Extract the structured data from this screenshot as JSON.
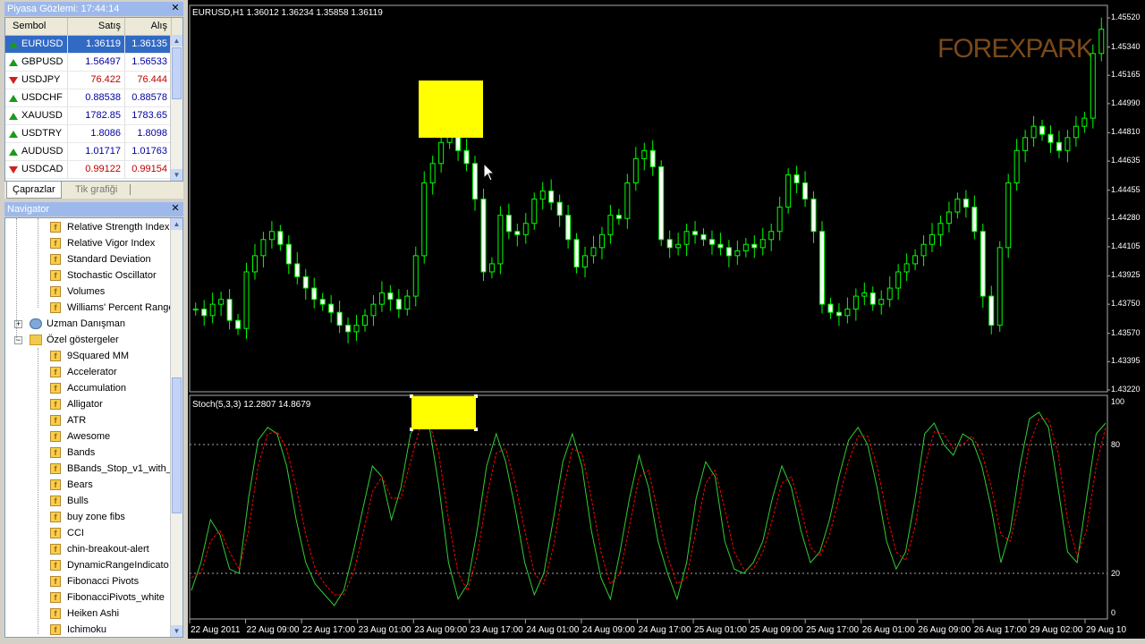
{
  "market_watch": {
    "title": "Piyasa Gözlemi: 17:44:14",
    "headers": {
      "symbol": "Sembol",
      "sell": "Satış",
      "buy": "Alış"
    },
    "rows": [
      {
        "symbol": "EURUSD",
        "sell": "1.36119",
        "buy": "1.36135",
        "dir": "up",
        "selected": true,
        "color": "#0000a0"
      },
      {
        "symbol": "GBPUSD",
        "sell": "1.56497",
        "buy": "1.56533",
        "dir": "up",
        "selected": false,
        "color": "#0000a0"
      },
      {
        "symbol": "USDJPY",
        "sell": "76.422",
        "buy": "76.444",
        "dir": "down",
        "selected": false,
        "color": "#c00000"
      },
      {
        "symbol": "USDCHF",
        "sell": "0.88538",
        "buy": "0.88578",
        "dir": "up",
        "selected": false,
        "color": "#0000a0"
      },
      {
        "symbol": "XAUUSD",
        "sell": "1782.85",
        "buy": "1783.65",
        "dir": "up",
        "selected": false,
        "color": "#0000a0"
      },
      {
        "symbol": "USDTRY",
        "sell": "1.8086",
        "buy": "1.8098",
        "dir": "up",
        "selected": false,
        "color": "#0000a0"
      },
      {
        "symbol": "AUDUSD",
        "sell": "1.01717",
        "buy": "1.01763",
        "dir": "up",
        "selected": false,
        "color": "#0000a0"
      },
      {
        "symbol": "USDCAD",
        "sell": "0.99122",
        "buy": "0.99154",
        "dir": "down",
        "selected": false,
        "color": "#c00000"
      }
    ],
    "tabs": [
      "Çaprazlar",
      "Tik grafiği"
    ]
  },
  "navigator": {
    "title": "Navigator",
    "items": [
      {
        "label": "Relative Strength Index",
        "level": 2,
        "type": "indicator"
      },
      {
        "label": "Relative Vigor Index",
        "level": 2,
        "type": "indicator"
      },
      {
        "label": "Standard Deviation",
        "level": 2,
        "type": "indicator"
      },
      {
        "label": "Stochastic Oscillator",
        "level": 2,
        "type": "indicator"
      },
      {
        "label": "Volumes",
        "level": 2,
        "type": "indicator"
      },
      {
        "label": "Williams' Percent Range",
        "level": 2,
        "type": "indicator"
      },
      {
        "label": "Uzman Danışman",
        "level": 1,
        "type": "ea",
        "expander": "+"
      },
      {
        "label": "Özel göstergeler",
        "level": 1,
        "type": "folder",
        "expander": "−"
      },
      {
        "label": "9Squared MM",
        "level": 2,
        "type": "custom"
      },
      {
        "label": "Accelerator",
        "level": 2,
        "type": "custom"
      },
      {
        "label": "Accumulation",
        "level": 2,
        "type": "custom"
      },
      {
        "label": "Alligator",
        "level": 2,
        "type": "custom"
      },
      {
        "label": "ATR",
        "level": 2,
        "type": "custom"
      },
      {
        "label": "Awesome",
        "level": 2,
        "type": "custom"
      },
      {
        "label": "Bands",
        "level": 2,
        "type": "custom"
      },
      {
        "label": "BBands_Stop_v1_with_",
        "level": 2,
        "type": "custom"
      },
      {
        "label": "Bears",
        "level": 2,
        "type": "custom"
      },
      {
        "label": "Bulls",
        "level": 2,
        "type": "custom"
      },
      {
        "label": "buy zone fibs",
        "level": 2,
        "type": "custom"
      },
      {
        "label": "CCI",
        "level": 2,
        "type": "custom"
      },
      {
        "label": "chin-breakout-alert",
        "level": 2,
        "type": "custom"
      },
      {
        "label": "DynamicRangeIndicato",
        "level": 2,
        "type": "custom"
      },
      {
        "label": "Fibonacci Pivots",
        "level": 2,
        "type": "custom"
      },
      {
        "label": "FibonacciPivots_white",
        "level": 2,
        "type": "custom"
      },
      {
        "label": "Heiken Ashi",
        "level": 2,
        "type": "custom"
      },
      {
        "label": "Ichimoku",
        "level": 2,
        "type": "custom"
      }
    ]
  },
  "chart": {
    "header": "EURUSD,H1  1.36012 1.36234 1.35858 1.36119",
    "logo": "FOREXPARK",
    "price_ticks": [
      "1.45520",
      "1.45340",
      "1.45165",
      "1.44990",
      "1.44810",
      "1.44635",
      "1.44455",
      "1.44280",
      "1.44105",
      "1.43925",
      "1.43750",
      "1.43570",
      "1.43395",
      "1.43220"
    ],
    "stoch_label": "Stoch(5,3,3) 12.2807 14.8679",
    "stoch_ticks": [
      "100",
      "80",
      "20",
      "0"
    ],
    "time_labels": [
      "22 Aug 2011",
      "22 Aug 09:00",
      "22 Aug 17:00",
      "23 Aug 01:00",
      "23 Aug 09:00",
      "23 Aug 17:00",
      "24 Aug 01:00",
      "24 Aug 09:00",
      "24 Aug 17:00",
      "25 Aug 01:00",
      "25 Aug 09:00",
      "25 Aug 17:00",
      "26 Aug 01:00",
      "26 Aug 09:00",
      "26 Aug 17:00",
      "29 Aug 02:00",
      "29 Aug 10"
    ],
    "candle_color": "#00ff00",
    "candle_body": "#ffffff",
    "stoch_main_color": "#32cd32",
    "stoch_signal_color": "#ff0000",
    "highlight_color": "#ffff00",
    "close_path": [
      1.4372,
      1.4368,
      1.4375,
      1.4378,
      1.4365,
      1.436,
      1.4395,
      1.4405,
      1.4415,
      1.442,
      1.4412,
      1.44,
      1.4392,
      1.4385,
      1.4378,
      1.4375,
      1.437,
      1.4362,
      1.4358,
      1.4362,
      1.4368,
      1.4375,
      1.4382,
      1.4378,
      1.4372,
      1.438,
      1.4405,
      1.445,
      1.4462,
      1.4475,
      1.448,
      1.447,
      1.4462,
      1.444,
      1.4395,
      1.44,
      1.443,
      1.442,
      1.4418,
      1.4425,
      1.444,
      1.4445,
      1.4438,
      1.443,
      1.4415,
      1.4398,
      1.4405,
      1.441,
      1.4418,
      1.443,
      1.4428,
      1.445,
      1.4465,
      1.447,
      1.446,
      1.4415,
      1.441,
      1.4412,
      1.442,
      1.4418,
      1.4415,
      1.4412,
      1.441,
      1.4405,
      1.4408,
      1.4412,
      1.441,
      1.4415,
      1.442,
      1.4435,
      1.4455,
      1.445,
      1.444,
      1.442,
      1.4375,
      1.437,
      1.4368,
      1.4372,
      1.438,
      1.4382,
      1.4375,
      1.4378,
      1.4385,
      1.4395,
      1.44,
      1.4405,
      1.4412,
      1.4418,
      1.4425,
      1.4432,
      1.444,
      1.4435,
      1.442,
      1.438,
      1.4362,
      1.441,
      1.445,
      1.447,
      1.4478,
      1.4485,
      1.448,
      1.4475,
      1.447,
      1.4478,
      1.4485,
      1.449,
      1.453,
      1.4545
    ],
    "stoch_main": [
      12,
      25,
      45,
      38,
      22,
      20,
      55,
      82,
      88,
      85,
      70,
      45,
      25,
      15,
      10,
      5,
      12,
      30,
      50,
      70,
      65,
      45,
      60,
      85,
      92,
      88,
      60,
      25,
      8,
      15,
      40,
      70,
      85,
      72,
      50,
      25,
      10,
      20,
      45,
      72,
      85,
      70,
      40,
      18,
      8,
      30,
      55,
      75,
      60,
      35,
      20,
      8,
      25,
      55,
      72,
      65,
      35,
      22,
      20,
      25,
      35,
      55,
      70,
      60,
      40,
      25,
      30,
      45,
      65,
      82,
      88,
      80,
      60,
      35,
      22,
      30,
      55,
      85,
      90,
      80,
      75,
      85,
      82,
      70,
      50,
      25,
      40,
      70,
      92,
      95,
      88,
      60,
      30,
      25,
      55,
      85,
      90
    ],
    "stoch_signal": [
      18,
      20,
      35,
      40,
      30,
      22,
      40,
      70,
      85,
      86,
      78,
      60,
      38,
      22,
      15,
      10,
      10,
      20,
      38,
      58,
      65,
      55,
      55,
      72,
      88,
      90,
      75,
      45,
      20,
      12,
      28,
      55,
      76,
      78,
      62,
      40,
      20,
      15,
      32,
      58,
      78,
      76,
      55,
      30,
      15,
      20,
      42,
      65,
      68,
      48,
      28,
      15,
      18,
      40,
      62,
      68,
      50,
      30,
      22,
      22,
      30,
      45,
      62,
      65,
      50,
      32,
      28,
      38,
      55,
      72,
      84,
      84,
      70,
      48,
      30,
      26,
      42,
      70,
      86,
      85,
      78,
      80,
      84,
      76,
      60,
      38,
      35,
      55,
      80,
      92,
      92,
      76,
      45,
      28,
      40,
      70,
      88
    ]
  }
}
